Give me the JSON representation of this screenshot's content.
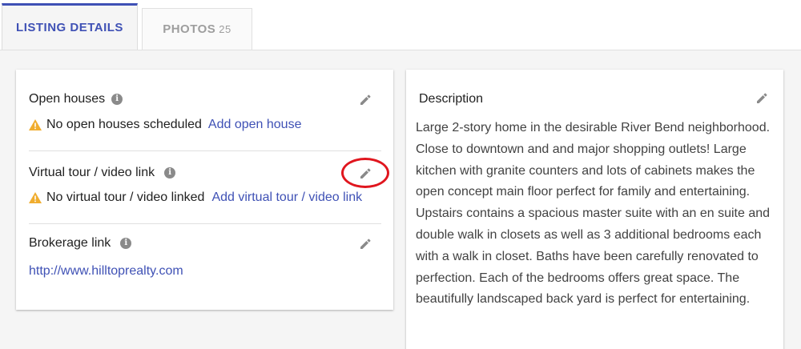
{
  "tabs": [
    {
      "label": "LISTING DETAILS",
      "count": ""
    },
    {
      "label": "PHOTOS",
      "count": "25"
    }
  ],
  "open_houses": {
    "title": "Open houses",
    "status": "No open houses scheduled",
    "action": "Add open house"
  },
  "virtual_tour": {
    "title": "Virtual tour / video link",
    "status": "No virtual tour / video linked",
    "action": "Add virtual tour / video link"
  },
  "brokerage": {
    "title": "Brokerage link",
    "url": "http://www.hilltoprealty.com"
  },
  "description": {
    "title": "Description",
    "text": "Large 2-story home in the desirable River Bend neighborhood. Close to downtown and and major shopping outlets!  Large kitchen with granite counters and lots of cabinets makes the open concept main floor perfect for family and entertaining. Upstairs contains a spacious master suite with an en suite and double walk in closets as well as 3 additional bedrooms each with a walk in closet.  Baths have been carefully renovated to perfection.  Each of the bedrooms offers great space.  The beautifully landscaped back yard is perfect for entertaining."
  },
  "colors": {
    "accent": "#3f51b5",
    "warning": "#f0ad2f",
    "highlight": "#e0161e"
  },
  "icons": [
    "info-icon",
    "pencil-icon",
    "warning-icon"
  ]
}
